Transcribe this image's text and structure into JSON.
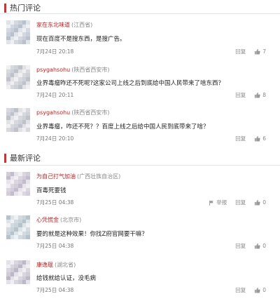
{
  "hot": {
    "title": "热门评论",
    "comments": [
      {
        "user": "家在东北味道",
        "location": "(江西省)",
        "text": "现在百度不是搜东西，是搜广告。",
        "time": "7月24日 20:18",
        "reply": "回复",
        "likes": "7"
      },
      {
        "user": "psygahsohu",
        "location": "(陕西省西安市)",
        "text": "业界毒瘤昨还不死呢?这家公司上线之后到底给中国人民带来了啥东西？",
        "time": "7月24日 20:11",
        "reply": "回复",
        "likes": "8"
      },
      {
        "user": "psygahsohu",
        "location": "(陕西省西安市)",
        "text": "业界毒瘤，咋还不死？？百度上线之后给中国人民到底带来了啥？",
        "time": "7月24日 20:10",
        "reply": "回复",
        "likes": "6"
      }
    ]
  },
  "latest": {
    "title": "最新评论",
    "comments": [
      {
        "user": "为自己打气加油",
        "location": "(广西壮族自治区)",
        "text": "百毒死要钱",
        "time": "7月25日 04:38",
        "report": "举报",
        "reply": "回复",
        "likes": "0"
      },
      {
        "user": "心凭慌金",
        "location": "(北京市)",
        "text": "要的就是这种效果！你找Z府官网要干嘛？",
        "time": "7月25日 04:38",
        "reply": "回复",
        "likes": "0"
      },
      {
        "user": "康逸琨",
        "location": "(湖北省)",
        "text": "给钱就给认证，没毛病",
        "time": "7月25日 04:38",
        "reply": "回复",
        "likes": "0"
      }
    ]
  },
  "colors": {
    "accent": "#c33",
    "username": "#c21f1f"
  }
}
